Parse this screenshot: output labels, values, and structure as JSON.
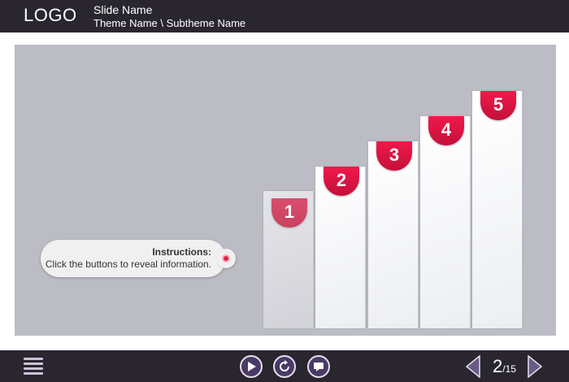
{
  "header": {
    "logo": "LOGO",
    "slide_name": "Slide Name",
    "theme_path": "Theme Name \\ Subtheme Name"
  },
  "instructions": {
    "title": "Instructions:",
    "text": "Click the buttons to reveal information."
  },
  "steps": [
    {
      "label": "1"
    },
    {
      "label": "2"
    },
    {
      "label": "3"
    },
    {
      "label": "4"
    },
    {
      "label": "5"
    }
  ],
  "footer": {
    "current_page": "2",
    "total_pages": "/15"
  },
  "colors": {
    "bar": "#2a2630",
    "stage": "#bbbcc4",
    "accent": "#e0234a",
    "control": "#4a3a66"
  }
}
